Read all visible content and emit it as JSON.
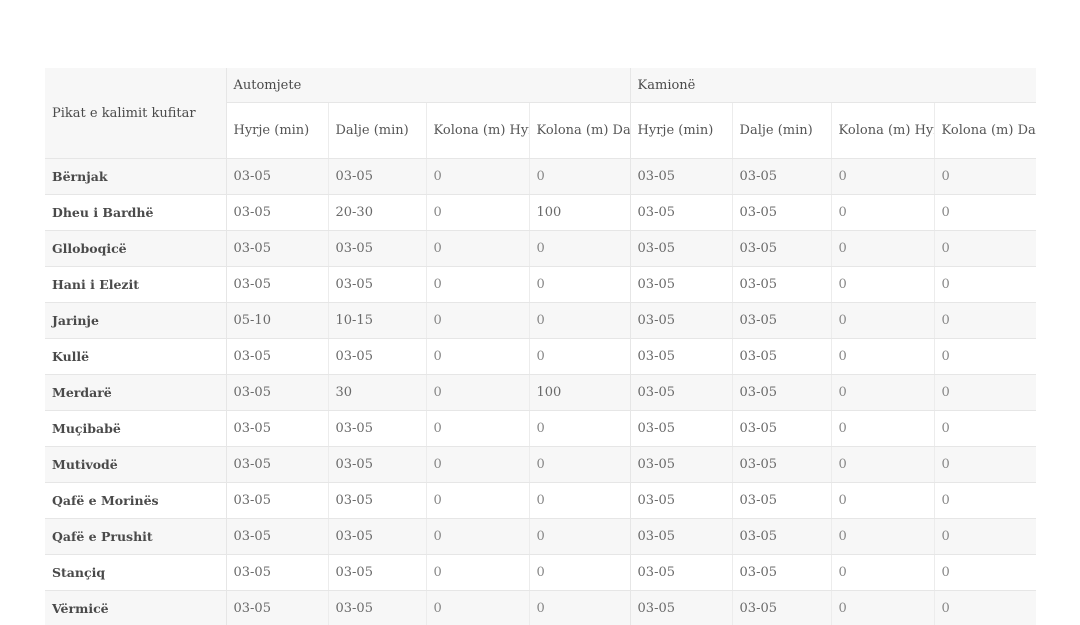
{
  "table": {
    "header": {
      "first_col": "Pikat e kalimit kufitar",
      "group_cars": "Automjete",
      "group_trucks": "Kamionë",
      "sub_cols": [
        "Hyrje (min)",
        "Dalje (min)",
        "Kolona (m) Hyrje",
        "Kolona (m) Dalje",
        "Hyrje (min)",
        "Dalje (min)",
        "Kolona (m) Hyrje",
        "Kolona (m) Dalje"
      ]
    },
    "rows": [
      {
        "name": "Bërnjak",
        "cells": [
          "03-05",
          "03-05",
          "0",
          "0",
          "03-05",
          "03-05",
          "0",
          "0"
        ]
      },
      {
        "name": "Dheu i Bardhë",
        "cells": [
          "03-05",
          "20-30",
          "0",
          "100",
          "03-05",
          "03-05",
          "0",
          "0"
        ]
      },
      {
        "name": "Glloboqicë",
        "cells": [
          "03-05",
          "03-05",
          "0",
          "0",
          "03-05",
          "03-05",
          "0",
          "0"
        ]
      },
      {
        "name": "Hani i Elezit",
        "cells": [
          "03-05",
          "03-05",
          "0",
          "0",
          "03-05",
          "03-05",
          "0",
          "0"
        ]
      },
      {
        "name": "Jarinje",
        "cells": [
          "05-10",
          "10-15",
          "0",
          "0",
          "03-05",
          "03-05",
          "0",
          "0"
        ]
      },
      {
        "name": "Kullë",
        "cells": [
          "03-05",
          "03-05",
          "0",
          "0",
          "03-05",
          "03-05",
          "0",
          "0"
        ]
      },
      {
        "name": "Merdarë",
        "cells": [
          "03-05",
          "30",
          "0",
          "100",
          "03-05",
          "03-05",
          "0",
          "0"
        ]
      },
      {
        "name": "Muçibabë",
        "cells": [
          "03-05",
          "03-05",
          "0",
          "0",
          "03-05",
          "03-05",
          "0",
          "0"
        ]
      },
      {
        "name": "Mutivodë",
        "cells": [
          "03-05",
          "03-05",
          "0",
          "0",
          "03-05",
          "03-05",
          "0",
          "0"
        ]
      },
      {
        "name": "Qafë e Morinës",
        "cells": [
          "03-05",
          "03-05",
          "0",
          "0",
          "03-05",
          "03-05",
          "0",
          "0"
        ]
      },
      {
        "name": "Qafë e Prushit",
        "cells": [
          "03-05",
          "03-05",
          "0",
          "0",
          "03-05",
          "03-05",
          "0",
          "0"
        ]
      },
      {
        "name": "Stançiq",
        "cells": [
          "03-05",
          "03-05",
          "0",
          "0",
          "03-05",
          "03-05",
          "0",
          "0"
        ]
      },
      {
        "name": "Vërmicë",
        "cells": [
          "03-05",
          "03-05",
          "0",
          "0",
          "03-05",
          "03-05",
          "0",
          "0"
        ]
      }
    ]
  }
}
